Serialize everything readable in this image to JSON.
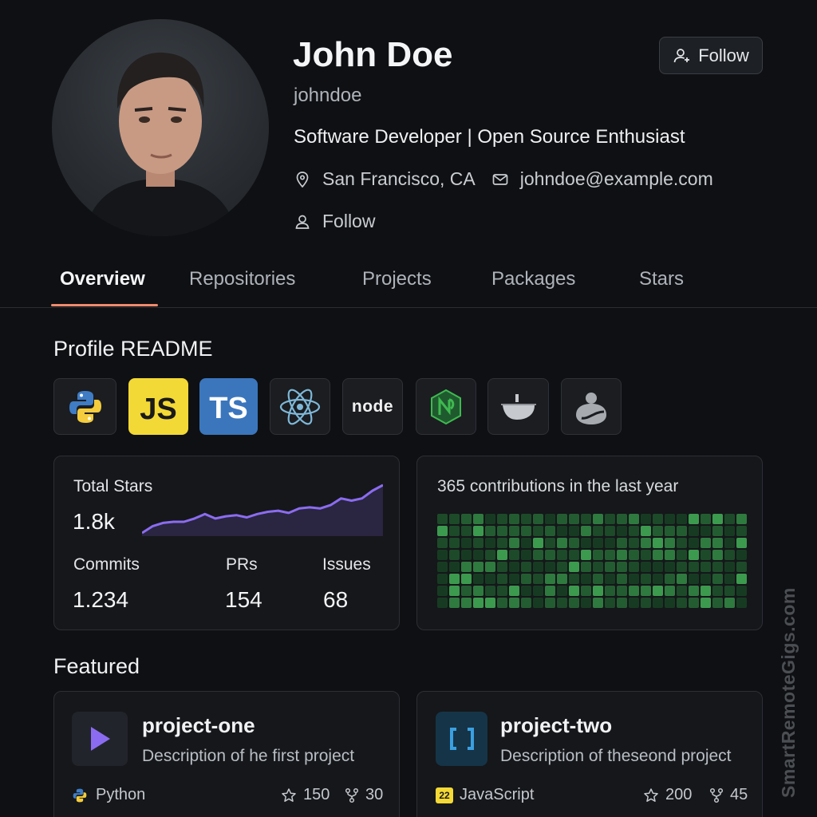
{
  "profile": {
    "name": "John Doe",
    "username": "johndoe",
    "bio": "Software Developer | Open Source Enthusiast",
    "location": "San Francisco, CA",
    "email": "johndoe@example.com",
    "follow_link": "Follow",
    "follow_button": "Follow"
  },
  "tabs": [
    {
      "label": "Overview",
      "active": true
    },
    {
      "label": "Repositories"
    },
    {
      "label": "Projects"
    },
    {
      "label": "Packages"
    },
    {
      "label": "Stars"
    }
  ],
  "readme": {
    "title": "Profile README",
    "tech_icons": [
      "python-icon",
      "javascript-icon",
      "typescript-icon",
      "react-icon",
      "node-icon",
      "nginx-icon",
      "docker-icon",
      "misc-icon"
    ],
    "tech_text": {
      "js": "JS",
      "ts": "TS",
      "node": "node"
    }
  },
  "stats": {
    "total_stars_label": "Total Stars",
    "total_stars_value": "1.8k",
    "commits_label": "Commits",
    "commits_value": "1.234",
    "prs_label": "PRs",
    "prs_value": "154",
    "issues_label": "Issues",
    "issues_value": "68",
    "sparkline": [
      2,
      8,
      11,
      12,
      12,
      15,
      19,
      15,
      17,
      18,
      16,
      19,
      21,
      22,
      20,
      24,
      25,
      24,
      27,
      33,
      31,
      33,
      40,
      45
    ]
  },
  "contributions": {
    "label": "365 contributions in the last year"
  },
  "featured": {
    "title": "Featured",
    "repos": [
      {
        "name": "project-one",
        "description": "Description of he first project",
        "language": "Python",
        "stars": "150",
        "forks": "30"
      },
      {
        "name": "project-two",
        "description": "Description of theseond project",
        "language": "JavaScript",
        "lang_badge": "22",
        "stars": "200",
        "forks": "45"
      }
    ]
  },
  "watermark": "SmartRemoteGigs.com",
  "colors": {
    "accent": "#f08a6d",
    "purple": "#8b6cf0",
    "green": "#3fb950"
  }
}
